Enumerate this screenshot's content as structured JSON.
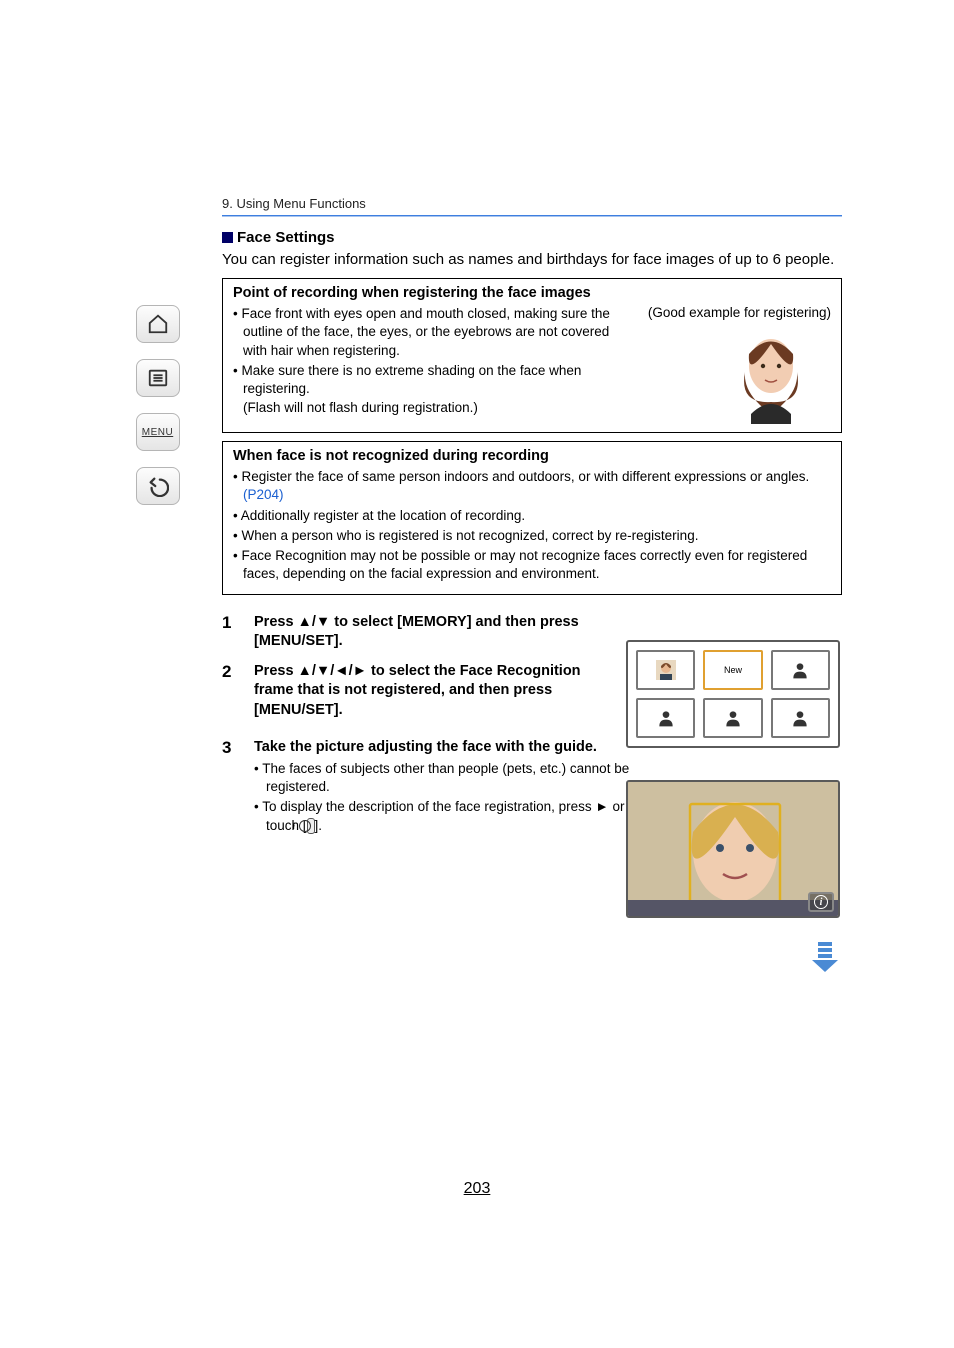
{
  "chapter": "9. Using Menu Functions",
  "section_title": "Face Settings",
  "intro": "You can register information such as names and birthdays for face images of up to 6 people.",
  "box1": {
    "title": "Point of recording when registering the face images",
    "good_example": "(Good example for registering)",
    "items": [
      "Face front with eyes open and mouth closed, making sure the outline of the face, the eyes, or the eyebrows are not covered with hair when registering.",
      "Make sure there is no extreme shading on the face when registering."
    ],
    "note": "(Flash will not flash during registration.)"
  },
  "box2": {
    "title": "When face is not recognized during recording",
    "items_pre": "Register the face of same person indoors and outdoors, or with different expressions or angles. ",
    "link": "(P204)",
    "items_rest": [
      "Additionally register at the location of recording.",
      "When a person who is registered is not recognized, correct by re-registering.",
      "Face Recognition may not be possible or may not recognize faces correctly even for registered faces, depending on the facial expression and environment."
    ]
  },
  "steps": {
    "s1": "Press ▲/▼ to select [MEMORY] and then press [MENU/SET].",
    "s2": "Press ▲/▼/◄/► to select the Face Recognition frame that is not registered, and then press [MENU/SET].",
    "s3": "Take the picture adjusting the face with the guide.",
    "s3a": "The faces of subjects other than people (pets, etc.) cannot be registered.",
    "s3b_pre": "To display the description of the face registration, press ► or touch [",
    "s3b_post": "]."
  },
  "grid_new": "New",
  "sidebar_menu": "MENU",
  "page_number": "203"
}
